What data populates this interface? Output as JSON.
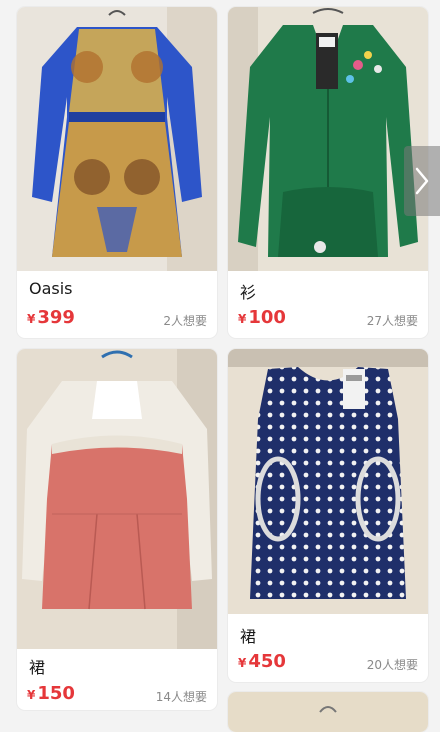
{
  "currency_symbol": "¥",
  "products": [
    {
      "title": "Oasis",
      "price": "399",
      "wants": "2人想要"
    },
    {
      "title": "衫",
      "price": "100",
      "wants": "27人想要"
    },
    {
      "title": "裙",
      "price": "150",
      "wants": "14人想要"
    },
    {
      "title": "裙",
      "price": "450",
      "wants": "20人想要"
    }
  ],
  "icons": {
    "carousel_next": "chevron-right-icon"
  },
  "colors": {
    "price": "#e5373a",
    "meta": "#8a8a8a",
    "background": "#f3f3f3"
  }
}
